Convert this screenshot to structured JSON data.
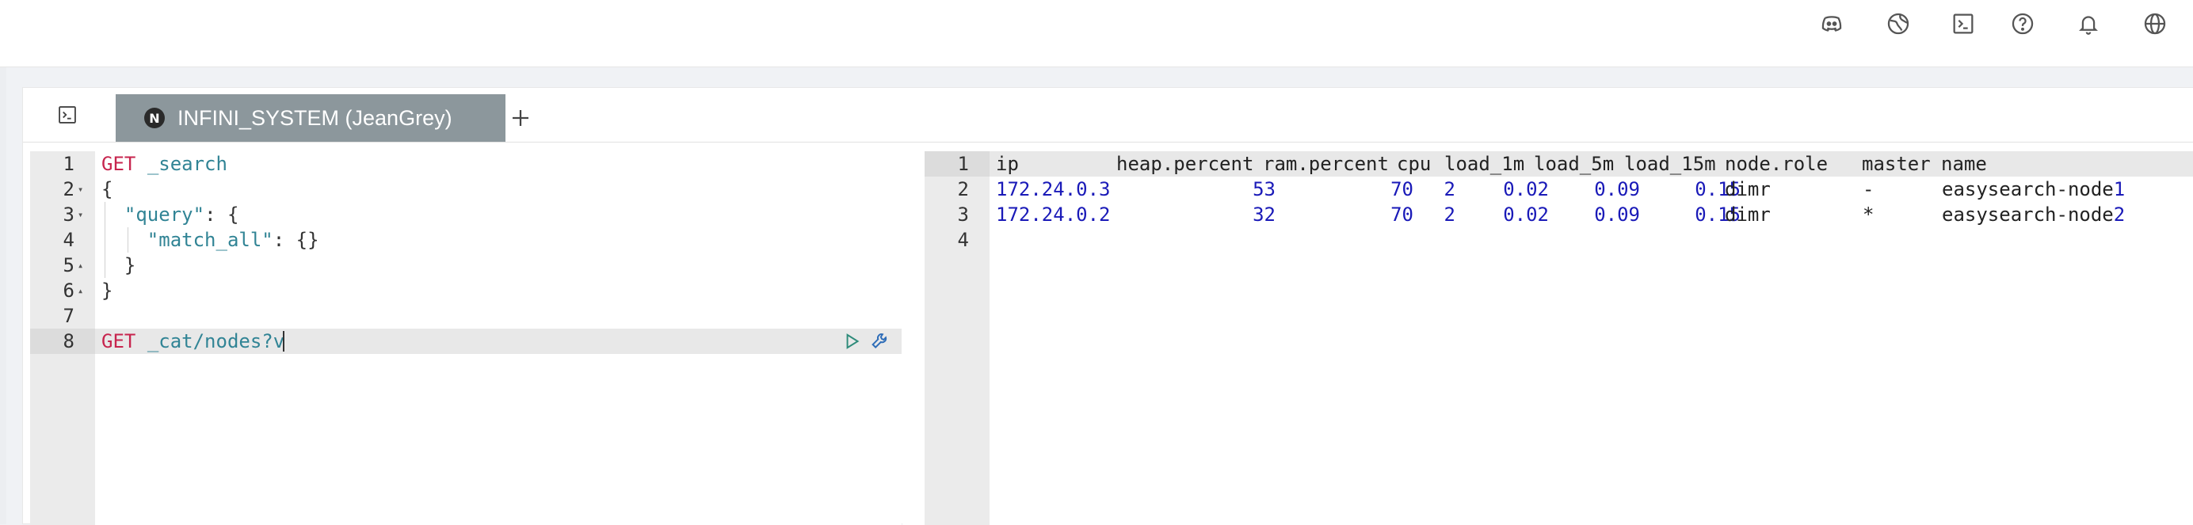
{
  "topbar": {
    "icons": [
      "discord-icon",
      "globe-off-icon",
      "terminal-icon",
      "help-icon",
      "bell-icon",
      "language-icon"
    ]
  },
  "tabs": {
    "console_icon": "terminal-icon",
    "active_tab_label": "INFINI_SYSTEM (JeanGrey)",
    "active_tab_icon": "cluster-logo-icon",
    "add_label": "+"
  },
  "editor": {
    "lines": [
      {
        "num": "1",
        "fold": "",
        "parts": [
          {
            "t": "GET",
            "c": "kw"
          },
          {
            "t": " "
          },
          {
            "t": "_search",
            "c": "path"
          }
        ]
      },
      {
        "num": "2",
        "fold": "▾",
        "parts": [
          {
            "t": "{"
          }
        ]
      },
      {
        "num": "3",
        "fold": "▾",
        "parts": [
          {
            "t": "  "
          },
          {
            "t": "\"query\"",
            "c": "str"
          },
          {
            "t": ": {"
          }
        ]
      },
      {
        "num": "4",
        "fold": "",
        "parts": [
          {
            "t": "    "
          },
          {
            "t": "\"match_all\"",
            "c": "str"
          },
          {
            "t": ": {}"
          }
        ]
      },
      {
        "num": "5",
        "fold": "▴",
        "parts": [
          {
            "t": "  }"
          }
        ]
      },
      {
        "num": "6",
        "fold": "▴",
        "parts": [
          {
            "t": "}"
          }
        ]
      },
      {
        "num": "7",
        "fold": "",
        "parts": []
      },
      {
        "num": "8",
        "fold": "",
        "parts": [
          {
            "t": "GET",
            "c": "kw"
          },
          {
            "t": " "
          },
          {
            "t": "_cat/nodes?v",
            "c": "path"
          }
        ]
      }
    ],
    "active_line": 8,
    "run_icon": "play-icon",
    "wrench_icon": "wrench-icon"
  },
  "output": {
    "line_numbers": [
      "1",
      "2",
      "3",
      "4"
    ],
    "columns": [
      "ip",
      "heap.percent",
      "ram.percent",
      "cpu",
      "load_1m",
      "load_5m",
      "load_15m",
      "node.role",
      "master",
      "name"
    ],
    "rows": [
      [
        "172.24.0.3",
        "53",
        "70",
        "2",
        "0.02",
        "0.09",
        "0.15",
        "dimr",
        "-",
        "easysearch-node1"
      ],
      [
        "172.24.0.2",
        "32",
        "70",
        "2",
        "0.02",
        "0.09",
        "0.15",
        "dimr",
        "*",
        "easysearch-node2"
      ]
    ]
  },
  "colors": {
    "keyword": "#c7254e",
    "path": "#318495",
    "number": "#1a1ab8",
    "tab_active": "#8c979c"
  }
}
